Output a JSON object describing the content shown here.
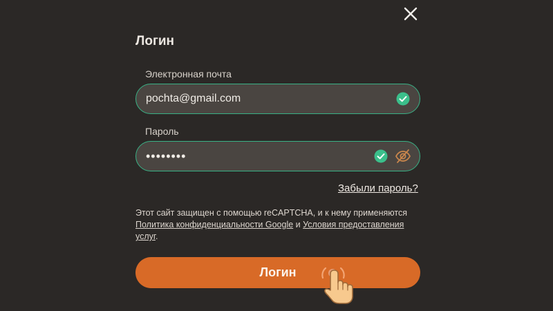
{
  "form": {
    "title": "Логин",
    "email_label": "Электронная почта",
    "email_value": "pochta@gmail.com",
    "password_label": "Пароль",
    "password_value": "••••••••",
    "forgot_link": "Забыли пароль?",
    "notice": {
      "text_before": "Этот сайт защищен с помощью reCAPTCHA, и к нему применяются ",
      "privacy_link": "Политика конфиденциальности Google",
      "text_and": " и ",
      "terms_link": "Условия предоставления услуг",
      "text_after": "."
    },
    "submit_label": "Логин"
  },
  "icons": {
    "close": "close-icon",
    "valid": "check-circle-icon",
    "password_hidden": "eye-off-icon",
    "pointer": "hand-pointer-icon"
  },
  "colors": {
    "background": "#2b2826",
    "input_bg": "#4a4541",
    "valid_border": "#39b286",
    "check_green": "#3bbf8b",
    "accent_orange": "#d86a27",
    "eye_icon": "#c9864c"
  }
}
